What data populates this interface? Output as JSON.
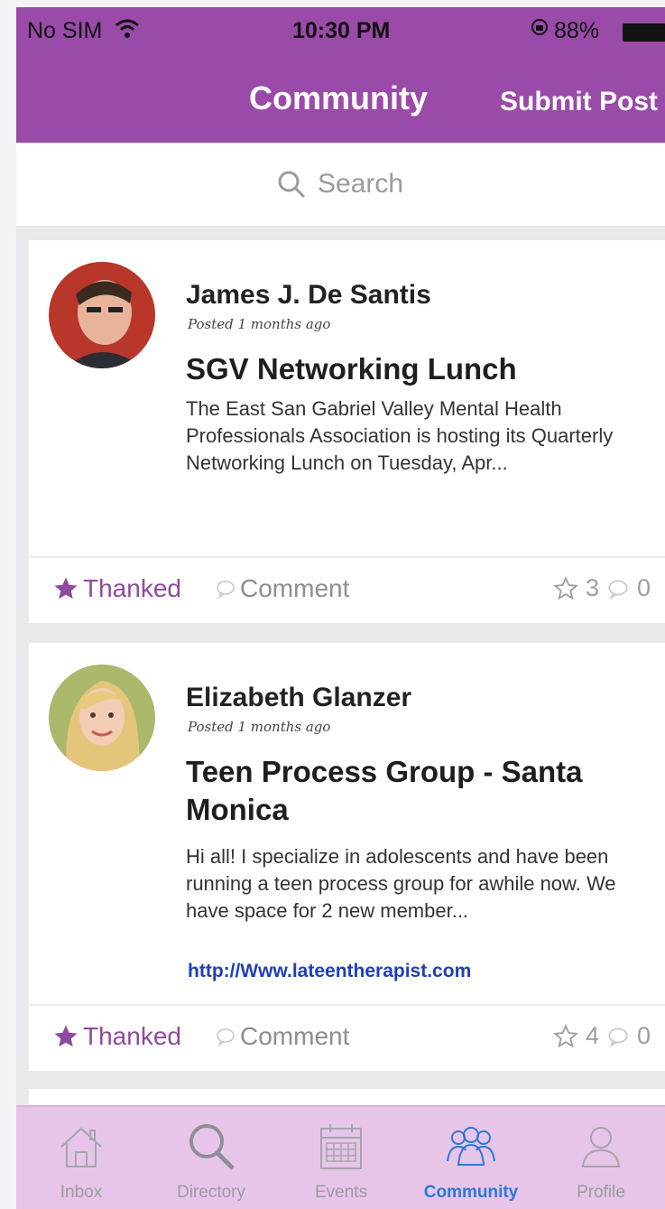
{
  "status_bar": {
    "carrier": "No SIM",
    "time": "10:30 PM",
    "battery": "88%",
    "wifi_icon": "wifi-icon",
    "lock_icon": "orientation-lock-icon"
  },
  "nav": {
    "title": "Community",
    "submit_label": "Submit Post",
    "color": "#9a4aa8"
  },
  "search": {
    "placeholder": "Search"
  },
  "posts": [
    {
      "author": "James J. De Santis",
      "posted": "Posted 1 months ago",
      "title": "SGV Networking Lunch",
      "body": "The East San Gabriel Valley Mental Health Professionals Association is hosting its Quarterly Networking Lunch on Tuesday, Apr...",
      "thanked_label": "Thanked",
      "comment_label": "Comment",
      "thanks_count": "3",
      "comment_count": "0"
    },
    {
      "author": "Elizabeth Glanzer",
      "posted": "Posted 1 months ago",
      "title": "Teen Process Group - Santa Monica",
      "body": "Hi all! I specialize in adolescents and have been running a teen process group for awhile now. We have space for 2 new member...",
      "link": "http://Www.lateentherapist.com",
      "thanked_label": "Thanked",
      "comment_label": "Comment",
      "thanks_count": "4",
      "comment_count": "0"
    }
  ],
  "tabs": [
    {
      "label": "Inbox",
      "icon": "home-icon",
      "active": false
    },
    {
      "label": "Directory",
      "icon": "search-icon",
      "active": false
    },
    {
      "label": "Events",
      "icon": "calendar-icon",
      "active": false
    },
    {
      "label": "Community",
      "icon": "group-icon",
      "active": true
    },
    {
      "label": "Profile",
      "icon": "person-icon",
      "active": false
    }
  ],
  "colors": {
    "accent": "#9a4aa8",
    "tab_active": "#2b78d8",
    "tabbar_bg": "#e6c5e8",
    "link": "#1f3fb5"
  }
}
